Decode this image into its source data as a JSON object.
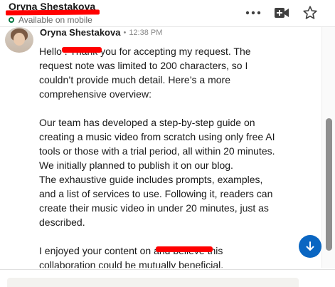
{
  "header": {
    "contact_name": "Oryna Shestakova",
    "status": "Available on mobile",
    "icons": [
      "more-options-icon",
      "video-call-icon",
      "star-icon"
    ]
  },
  "message": {
    "sender": "Oryna Shestakova",
    "separator": "•",
    "time": "12:38 PM",
    "lines": [
      "Hello            . Thank you for accepting my request. The",
      "request note was limited to 200 characters, so I",
      "couldn’t provide much detail. Here’s a more",
      "comprehensive overview:",
      "",
      "Our team has developed a step-by-step guide on",
      "creating a music video from scratch using only free AI",
      "tools or those with a trial period, all within 20 minutes.",
      "We initially planned to publish it on our blog.",
      "The exhaustive guide includes prompts, examples,",
      "and a list of services to use. Following it, readers can",
      "create their music video in under 20 minutes, just as",
      "described.",
      "",
      "I enjoyed your content on                        and believe this",
      "collaboration could be mutually beneficial."
    ]
  },
  "colors": {
    "accent": "#0a66c2",
    "online": "#057642",
    "redaction": "#ff0000"
  }
}
